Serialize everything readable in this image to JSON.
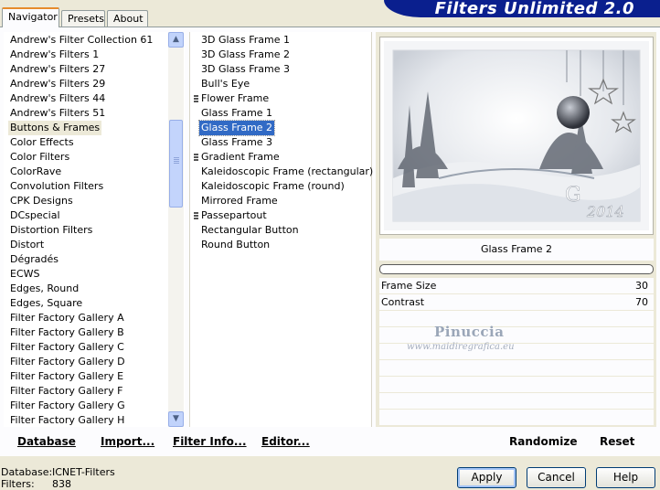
{
  "banner": {
    "title": "Filters Unlimited 2.0"
  },
  "tabs": [
    {
      "label": "Navigator",
      "active": true
    },
    {
      "label": "Presets",
      "active": false
    },
    {
      "label": "About",
      "active": false
    }
  ],
  "categories": [
    "Andrew's Filter Collection 61",
    "Andrew's Filters 1",
    "Andrew's Filters 27",
    "Andrew's Filters 29",
    "Andrew's Filters 44",
    "Andrew's Filters 51",
    "Buttons & Frames",
    "Color Effects",
    "Color Filters",
    "ColorRave",
    "Convolution Filters",
    "CPK Designs",
    "DCspecial",
    "Distortion Filters",
    "Distort",
    "Dégradés",
    "ECWS",
    "Edges, Round",
    "Edges, Square",
    "Filter Factory Gallery A",
    "Filter Factory Gallery B",
    "Filter Factory Gallery C",
    "Filter Factory Gallery D",
    "Filter Factory Gallery E",
    "Filter Factory Gallery F",
    "Filter Factory Gallery G",
    "Filter Factory Gallery H"
  ],
  "selected_category_index": 6,
  "filters": [
    {
      "label": "3D Glass Frame 1",
      "grip": false
    },
    {
      "label": "3D Glass Frame 2",
      "grip": false
    },
    {
      "label": "3D Glass Frame 3",
      "grip": false
    },
    {
      "label": "Bull's Eye",
      "grip": false
    },
    {
      "label": "Flower Frame",
      "grip": true
    },
    {
      "label": "Glass Frame 1",
      "grip": false
    },
    {
      "label": "Glass Frame 2",
      "grip": false
    },
    {
      "label": "Glass Frame 3",
      "grip": false
    },
    {
      "label": "Gradient Frame",
      "grip": true
    },
    {
      "label": "Kaleidoscopic Frame (rectangular)",
      "grip": false
    },
    {
      "label": "Kaleidoscopic Frame (round)",
      "grip": false
    },
    {
      "label": "Mirrored Frame",
      "grip": false
    },
    {
      "label": "Passepartout",
      "grip": true
    },
    {
      "label": "Rectangular Button",
      "grip": false
    },
    {
      "label": "Round Button",
      "grip": false
    }
  ],
  "selected_filter_index": 6,
  "preview": {
    "year_text": "2014",
    "greeting_initial": "G"
  },
  "filter_name": "Glass Frame 2",
  "params": [
    {
      "label": "Frame Size",
      "value": "30"
    },
    {
      "label": "Contrast",
      "value": "70"
    }
  ],
  "watermark": {
    "name": "Pinuccia",
    "url": "www.maidiregrafica.eu"
  },
  "bottom_links": {
    "database": "Database",
    "import": "Import...",
    "filter_info": "Filter Info...",
    "editor": "Editor...",
    "randomize": "Randomize",
    "reset": "Reset"
  },
  "status": {
    "database_label": "Database:",
    "database_value": "ICNET-Filters",
    "filters_label": "Filters:",
    "filters_value": "838"
  },
  "buttons": {
    "apply": "Apply",
    "cancel": "Cancel",
    "help": "Help"
  },
  "colors": {
    "banner": "#0a1f8e",
    "selection": "#316ac5",
    "panel": "#ece9d8"
  },
  "icons": {
    "scroll_up": "chevron-up-icon",
    "scroll_down": "chevron-down-icon",
    "grip": "grip-icon"
  }
}
